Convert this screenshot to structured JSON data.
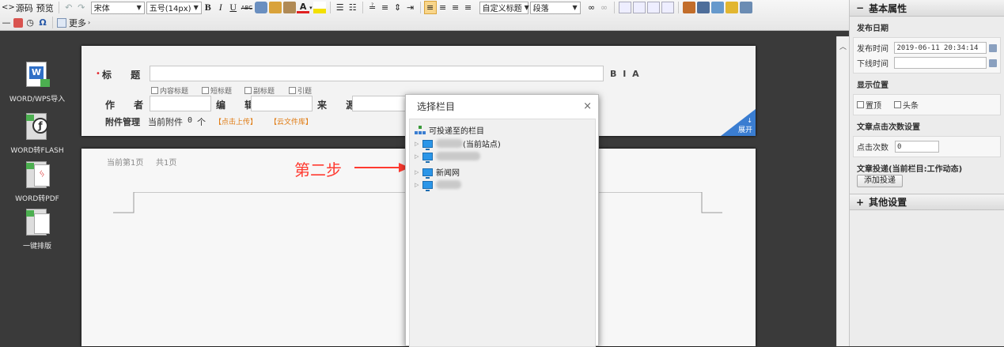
{
  "toolbar": {
    "source_label": "源码",
    "preview_label": "预览",
    "font_family": "宋体",
    "font_size": "五号(14px)",
    "bold": "B",
    "italic": "I",
    "underline": "U",
    "strike": "ABC",
    "font_color": "A",
    "heading_style": "自定义标题",
    "paragraph_style": "段落",
    "more_label": "更多"
  },
  "left_tools": [
    {
      "label": "WORD/WPS导入",
      "icon": "word-import-icon"
    },
    {
      "label": "WORD转FLASH",
      "icon": "word-to-flash-icon"
    },
    {
      "label": "WORD转PDF",
      "icon": "word-to-pdf-icon"
    },
    {
      "label": "一键排版",
      "icon": "one-click-format-icon"
    }
  ],
  "meta": {
    "title_label": "标 题",
    "title_checks": [
      "内容标题",
      "短标题",
      "副标题",
      "引题"
    ],
    "author_label": "作 者",
    "editor_label": "编 辑",
    "source_label": "来 源",
    "attach_label": "附件管理",
    "current_attach_label": "当前附件",
    "current_attach_count": "0",
    "current_attach_unit": "个",
    "upload_link": "【点击上传】",
    "cloud_link": "【云文件库】",
    "expand_label": "展开",
    "title_tools": "B I A"
  },
  "doc": {
    "page_info": "当前第1页",
    "total_pages": "共1页"
  },
  "dialog": {
    "title": "选择栏目",
    "close": "×",
    "root_label": "可投递至的栏目",
    "nodes": [
      {
        "label": "(当前站点)"
      },
      {
        "label": ""
      },
      {
        "label": "新闻网"
      },
      {
        "label": ""
      }
    ]
  },
  "annotation": {
    "step_text": "第二步"
  },
  "sidebar": {
    "basic_section": "基本属性",
    "publish_date_heading": "发布日期",
    "publish_time_label": "发布时间",
    "publish_time_value": "2019-06-11 20:34:14",
    "offline_time_label": "下线时间",
    "offline_time_value": "",
    "display_pos_heading": "显示位置",
    "pin_top_label": "置顶",
    "headline_label": "头条",
    "click_count_heading": "文章点击次数设置",
    "click_count_label": "点击次数",
    "click_count_value": "0",
    "delivery_heading": "文章投递(当前栏目:工作动态)",
    "add_delivery_button": "添加投递",
    "other_section": "其他设置"
  },
  "colors": {
    "accent_blue": "#3a7dd1",
    "annotation_red": "#ff3a30"
  }
}
